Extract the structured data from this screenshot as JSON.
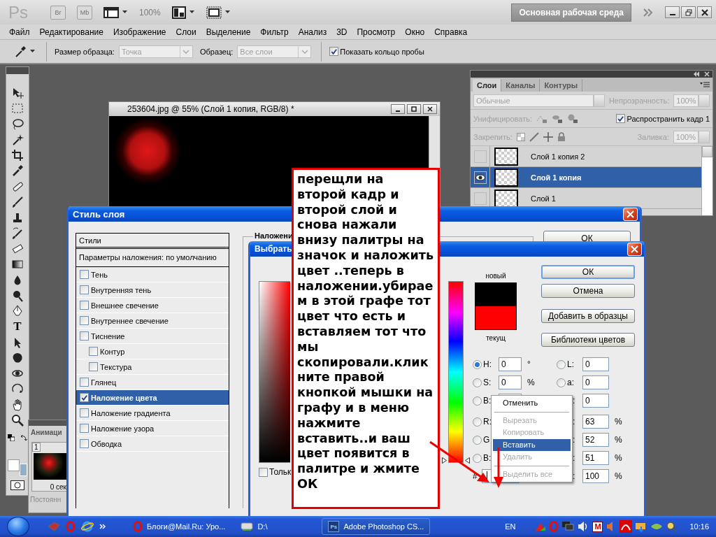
{
  "app_bar": {
    "logo": "Ps",
    "bridge": "Br",
    "mini_bridge": "Mb",
    "zoom": "100%",
    "workspace": "Основная рабочая среда"
  },
  "menu": [
    "Файл",
    "Редактирование",
    "Изображение",
    "Слои",
    "Выделение",
    "Фильтр",
    "Анализ",
    "3D",
    "Просмотр",
    "Окно",
    "Справка"
  ],
  "options_bar": {
    "sample_size_label": "Размер образца:",
    "sample_size": "Точка",
    "sample_label": "Образец:",
    "sample": "Все слои",
    "show_ring": {
      "label": "Показать кольцо пробы",
      "checked": true
    }
  },
  "toolbox": {
    "type_tool": "T"
  },
  "document": {
    "title": "253604.jpg @ 55% (Слой 1 копия, RGB/8) *"
  },
  "layers_panel": {
    "tabs": [
      {
        "label": "Слои",
        "selected": true
      },
      {
        "label": "Каналы",
        "selected": false
      },
      {
        "label": "Контуры",
        "selected": false
      }
    ],
    "blend_mode": "Обычные",
    "opacity_label": "Непрозрачность:",
    "opacity": "100%",
    "unify_label": "Унифицировать:",
    "propagate": {
      "label": "Распространить кадр 1",
      "checked": true
    },
    "lock_label": "Закрепить:",
    "fill_label": "Заливка:",
    "fill": "100%",
    "layers": [
      {
        "name": "Слой 1 копия 2",
        "visible": false,
        "selected": false
      },
      {
        "name": "Слой 1 копия",
        "visible": true,
        "selected": true
      },
      {
        "name": "Слой 1",
        "visible": false,
        "selected": false
      }
    ]
  },
  "animation_panel": {
    "title": "Анимаци",
    "frame_number": "1",
    "frame_delay": "0 сек",
    "loop": "Постоянн"
  },
  "layer_style_dialog": {
    "title": "Стиль слоя",
    "styles_header": "Стили",
    "blending_options": "Параметры наложения: по умолчанию",
    "section_title": "Наложени",
    "ok": "ОК",
    "effects": [
      {
        "label": "Тень",
        "kind": "effect",
        "checked": false,
        "selected": false
      },
      {
        "label": "Внутренняя тень",
        "kind": "effect",
        "checked": false,
        "selected": false
      },
      {
        "label": "Внешнее свечение",
        "kind": "effect",
        "checked": false,
        "selected": false
      },
      {
        "label": "Внутреннее свечение",
        "kind": "effect",
        "checked": false,
        "selected": false
      },
      {
        "label": "Тиснение",
        "kind": "effect",
        "checked": false,
        "selected": false
      },
      {
        "label": "Контур",
        "kind": "sub_effect",
        "checked": false,
        "selected": false
      },
      {
        "label": "Текстура",
        "kind": "sub_effect",
        "checked": false,
        "selected": false
      },
      {
        "label": "Глянец",
        "kind": "effect",
        "checked": false,
        "selected": false
      },
      {
        "label": "Наложение цвета",
        "kind": "effect",
        "checked": true,
        "selected": true
      },
      {
        "label": "Наложение градиента",
        "kind": "effect",
        "checked": false,
        "selected": false
      },
      {
        "label": "Наложение узора",
        "kind": "effect",
        "checked": false,
        "selected": false
      },
      {
        "label": "Обводка",
        "kind": "effect",
        "checked": false,
        "selected": false
      }
    ]
  },
  "color_picker": {
    "title": "Выбрать",
    "new_label": "новый",
    "current_label": "текущ",
    "buttons": [
      "ОК",
      "Отмена",
      "Добавить в образцы",
      "Библиотеки цветов"
    ],
    "left_fields": [
      {
        "kind": "radio",
        "label": "H:",
        "value": "0",
        "unit": "°",
        "selected": true
      },
      {
        "kind": "radio",
        "label": "S:",
        "value": "0",
        "unit": "%",
        "selected": false
      },
      {
        "kind": "radio",
        "label": "B:",
        "selected": false
      },
      {
        "kind": "radio",
        "label": "R:",
        "selected": false
      },
      {
        "kind": "radio",
        "label": "G",
        "selected": false
      },
      {
        "kind": "radio",
        "label": "B:",
        "selected": false
      }
    ],
    "right_fields": [
      {
        "kind": "radio",
        "label": "L:",
        "value": "0",
        "selected": false
      },
      {
        "kind": "radio",
        "label": "a:",
        "value": "0",
        "selected": false
      },
      {
        "kind": "plain",
        "label": ":",
        "value": "0"
      },
      {
        "kind": "plain",
        "label": ":",
        "value": "63",
        "unit": "%"
      },
      {
        "kind": "plain",
        "label": ":",
        "value": "52",
        "unit": "%"
      },
      {
        "kind": "plain",
        "label": ":",
        "value": "51",
        "unit": "%"
      },
      {
        "kind": "plain",
        "label": ":",
        "value": "100",
        "unit": "%"
      }
    ],
    "hue_slider": {
      "level": 0
    },
    "hex_label": "#",
    "web_only": {
      "label": "Тольк",
      "checked": false
    }
  },
  "context_menu": [
    {
      "label": "Отменить",
      "disabled": false,
      "selected": false,
      "separator_after": true
    },
    {
      "label": "Вырезать",
      "disabled": true,
      "selected": false,
      "separator_after": false
    },
    {
      "label": "Копировать",
      "disabled": true,
      "selected": false,
      "separator_after": false
    },
    {
      "label": "Вставить",
      "disabled": false,
      "selected": true,
      "separator_after": false
    },
    {
      "label": "Удалить",
      "disabled": true,
      "selected": false,
      "separator_after": true
    },
    {
      "label": "Выделить все",
      "disabled": true,
      "selected": false,
      "separator_after": false
    }
  ],
  "callout": {
    "text": "перещли на второй кадр и второй слой и снова нажали внизу палитры на значок и наложить цвет ..теперь в наложении.убираем в этой графе тот цвет что есть и вставляем тот что мы скопировали.кликните правой кнопкой мышки на графу и в меню нажмите вставить..и ваш цвет появится в палитре и жмите ОК"
  },
  "taskbar": {
    "tasks": [
      {
        "label": "Блоги@Mail.Ru: Уро...",
        "kind": "browser",
        "selected": false
      },
      {
        "label": "D:\\",
        "kind": "drive",
        "selected": false
      },
      {
        "label": "Adobe Photoshop CS...",
        "kind": "photoshop",
        "icon_text": "Ps",
        "selected": true
      }
    ],
    "language": "EN",
    "tray_badge": "M",
    "clock": "10:16"
  }
}
